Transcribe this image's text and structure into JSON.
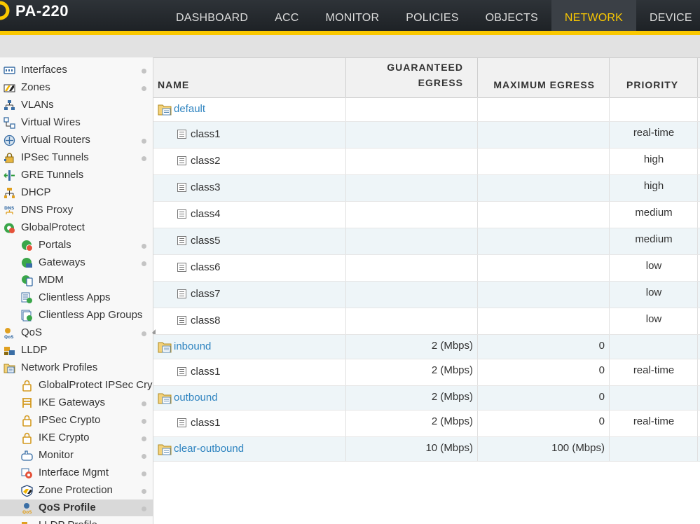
{
  "brand": {
    "name": "PA-220"
  },
  "tabs": [
    {
      "label": "DASHBOARD"
    },
    {
      "label": "ACC"
    },
    {
      "label": "MONITOR"
    },
    {
      "label": "POLICIES"
    },
    {
      "label": "OBJECTS"
    },
    {
      "label": "NETWORK",
      "active": true
    },
    {
      "label": "DEVICE"
    }
  ],
  "sidebar": {
    "items": [
      {
        "label": "Interfaces",
        "icon": "interfaces-icon",
        "level": 0,
        "dot": true
      },
      {
        "label": "Zones",
        "icon": "zones-icon",
        "level": 0,
        "dot": true
      },
      {
        "label": "VLANs",
        "icon": "vlans-icon",
        "level": 0,
        "dot": false
      },
      {
        "label": "Virtual Wires",
        "icon": "virtual-wires-icon",
        "level": 0,
        "dot": false
      },
      {
        "label": "Virtual Routers",
        "icon": "virtual-routers-icon",
        "level": 0,
        "dot": true
      },
      {
        "label": "IPSec Tunnels",
        "icon": "ipsec-tunnels-icon",
        "level": 0,
        "dot": true
      },
      {
        "label": "GRE Tunnels",
        "icon": "gre-tunnels-icon",
        "level": 0,
        "dot": false
      },
      {
        "label": "DHCP",
        "icon": "dhcp-icon",
        "level": 0,
        "dot": false
      },
      {
        "label": "DNS Proxy",
        "icon": "dns-proxy-icon",
        "level": 0,
        "dot": false
      },
      {
        "label": "GlobalProtect",
        "icon": "globalprotect-icon",
        "level": 0,
        "dot": false
      },
      {
        "label": "Portals",
        "icon": "portals-icon",
        "level": 1,
        "dot": true
      },
      {
        "label": "Gateways",
        "icon": "gateways-icon",
        "level": 1,
        "dot": true
      },
      {
        "label": "MDM",
        "icon": "mdm-icon",
        "level": 1,
        "dot": false
      },
      {
        "label": "Clientless Apps",
        "icon": "clientless-apps-icon",
        "level": 1,
        "dot": false
      },
      {
        "label": "Clientless App Groups",
        "icon": "clientless-app-groups-icon",
        "level": 1,
        "dot": false
      },
      {
        "label": "QoS",
        "icon": "qos-icon",
        "level": 0,
        "dot": true
      },
      {
        "label": "LLDP",
        "icon": "lldp-icon",
        "level": 0,
        "dot": false
      },
      {
        "label": "Network Profiles",
        "icon": "network-profiles-icon",
        "level": 0,
        "dot": false
      },
      {
        "label": "GlobalProtect IPSec Cryp",
        "icon": "lock-icon",
        "level": 1,
        "dot": false
      },
      {
        "label": "IKE Gateways",
        "icon": "ike-gateways-icon",
        "level": 1,
        "dot": true
      },
      {
        "label": "IPSec Crypto",
        "icon": "lock-icon",
        "level": 1,
        "dot": true
      },
      {
        "label": "IKE Crypto",
        "icon": "lock-icon",
        "level": 1,
        "dot": true
      },
      {
        "label": "Monitor",
        "icon": "monitor-icon",
        "level": 1,
        "dot": true
      },
      {
        "label": "Interface Mgmt",
        "icon": "interface-mgmt-icon",
        "level": 1,
        "dot": true
      },
      {
        "label": "Zone Protection",
        "icon": "zone-protection-icon",
        "level": 1,
        "dot": true
      },
      {
        "label": "QoS Profile",
        "icon": "qos-profile-icon",
        "level": 1,
        "dot": true,
        "selected": true
      },
      {
        "label": "LLDP Profile",
        "icon": "lldp-profile-icon",
        "level": 1,
        "dot": false
      }
    ]
  },
  "table": {
    "columns": {
      "name": "NAME",
      "guaranteed_egress": "GUARANTEED EGRESS",
      "maximum_egress": "MAXIMUM EGRESS",
      "priority": "PRIORITY"
    },
    "rows": [
      {
        "type": "profile",
        "name": "default",
        "guaranteed": "",
        "maximum": "",
        "priority": ""
      },
      {
        "type": "class",
        "name": "class1",
        "guaranteed": "",
        "maximum": "",
        "priority": "real-time"
      },
      {
        "type": "class",
        "name": "class2",
        "guaranteed": "",
        "maximum": "",
        "priority": "high"
      },
      {
        "type": "class",
        "name": "class3",
        "guaranteed": "",
        "maximum": "",
        "priority": "high"
      },
      {
        "type": "class",
        "name": "class4",
        "guaranteed": "",
        "maximum": "",
        "priority": "medium"
      },
      {
        "type": "class",
        "name": "class5",
        "guaranteed": "",
        "maximum": "",
        "priority": "medium"
      },
      {
        "type": "class",
        "name": "class6",
        "guaranteed": "",
        "maximum": "",
        "priority": "low"
      },
      {
        "type": "class",
        "name": "class7",
        "guaranteed": "",
        "maximum": "",
        "priority": "low"
      },
      {
        "type": "class",
        "name": "class8",
        "guaranteed": "",
        "maximum": "",
        "priority": "low"
      },
      {
        "type": "profile",
        "name": "inbound",
        "guaranteed": "2 (Mbps)",
        "maximum": "0",
        "priority": ""
      },
      {
        "type": "class",
        "name": "class1",
        "guaranteed": "2 (Mbps)",
        "maximum": "0",
        "priority": "real-time"
      },
      {
        "type": "profile",
        "name": "outbound",
        "guaranteed": "2 (Mbps)",
        "maximum": "0",
        "priority": ""
      },
      {
        "type": "class",
        "name": "class1",
        "guaranteed": "2 (Mbps)",
        "maximum": "0",
        "priority": "real-time"
      },
      {
        "type": "profile",
        "name": "clear-outbound",
        "guaranteed": "10 (Mbps)",
        "maximum": "100 (Mbps)",
        "priority": ""
      }
    ]
  },
  "colors": {
    "accent": "#fac800",
    "link": "#2f84c0",
    "row_alt": "#eef5f8",
    "topbar": "#24282c"
  }
}
